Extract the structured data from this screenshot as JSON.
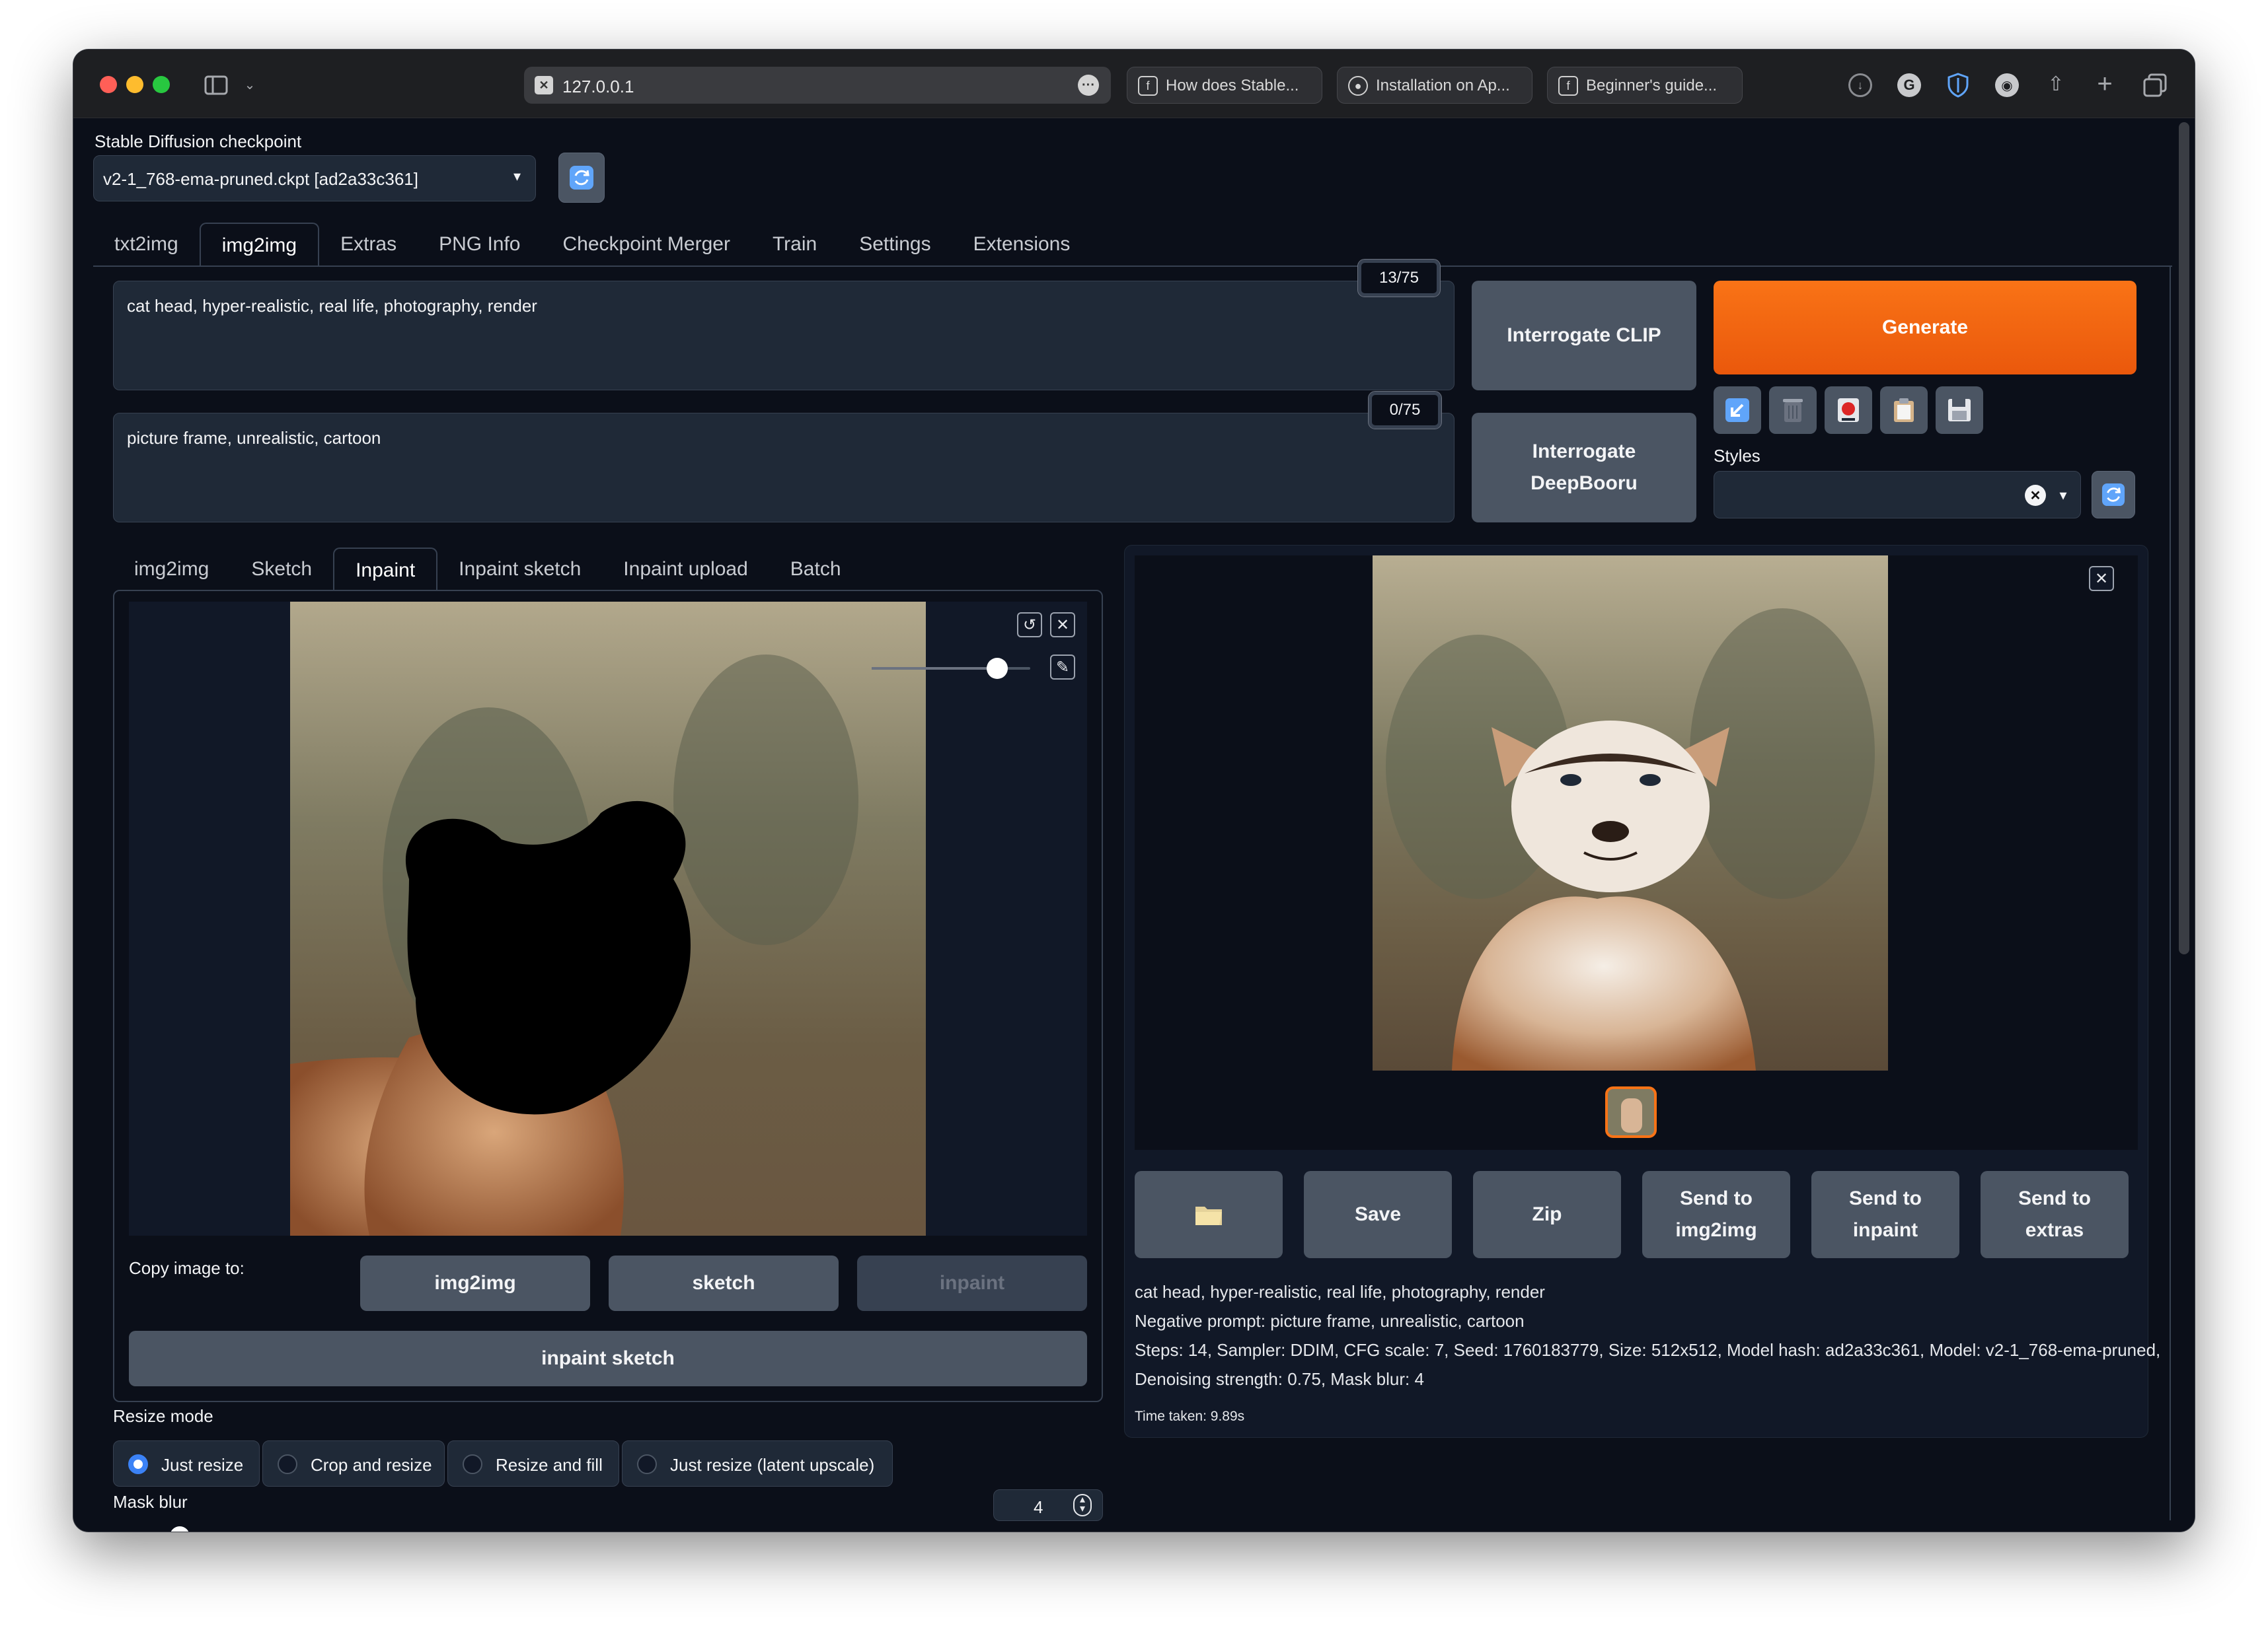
{
  "browser": {
    "url": "127.0.0.1",
    "tabs": [
      "How does Stable...",
      "Installation on Ap...",
      "Beginner's guide..."
    ]
  },
  "checkpoint": {
    "label": "Stable Diffusion checkpoint",
    "value": "v2-1_768-ema-pruned.ckpt [ad2a33c361]"
  },
  "main_tabs": [
    "txt2img",
    "img2img",
    "Extras",
    "PNG Info",
    "Checkpoint Merger",
    "Train",
    "Settings",
    "Extensions"
  ],
  "prompt": {
    "value": "cat head, hyper-realistic, real life, photography, render",
    "counter": "13/75"
  },
  "negative_prompt": {
    "value": "picture frame, unrealistic, cartoon",
    "counter": "0/75"
  },
  "buttons": {
    "interrogate_clip": "Interrogate CLIP",
    "interrogate_deepbooru_1": "Interrogate",
    "interrogate_deepbooru_2": "DeepBooru",
    "generate": "Generate"
  },
  "styles_label": "Styles",
  "sub_tabs": [
    "img2img",
    "Sketch",
    "Inpaint",
    "Inpaint sketch",
    "Inpaint upload",
    "Batch"
  ],
  "copy_image": {
    "label": "Copy image to:",
    "img2img": "img2img",
    "sketch": "sketch",
    "inpaint": "inpaint",
    "inpaint_sketch": "inpaint sketch"
  },
  "resize_mode": {
    "label": "Resize mode",
    "options": [
      "Just resize",
      "Crop and resize",
      "Resize and fill",
      "Just resize (latent upscale)"
    ],
    "selected": "Just resize"
  },
  "mask_blur": {
    "label": "Mask blur",
    "value": "4"
  },
  "output_buttons": {
    "folder_icon": "folder-icon",
    "save": "Save",
    "zip": "Zip",
    "send_img2img_1": "Send to",
    "send_img2img_2": "img2img",
    "send_inpaint_1": "Send to",
    "send_inpaint_2": "inpaint",
    "send_extras_1": "Send to",
    "send_extras_2": "extras"
  },
  "generation_info": {
    "prompt": "cat head, hyper-realistic, real life, photography, render",
    "negative": "Negative prompt: picture frame, unrealistic, cartoon",
    "params_1": "Steps: 14, Sampler: DDIM, CFG scale: 7, Seed: 1760183779, Size: 512x512, Model hash: ad2a33c361, Model: v2-1_768-ema-pruned,",
    "params_2": "Denoising strength: 0.75, Mask blur: 4",
    "time": "Time taken: 9.89s"
  },
  "colors": {
    "accent": "#f97316",
    "background": "#0b0f19",
    "button": "#4b5563",
    "radio_selected": "#3b82f6"
  }
}
